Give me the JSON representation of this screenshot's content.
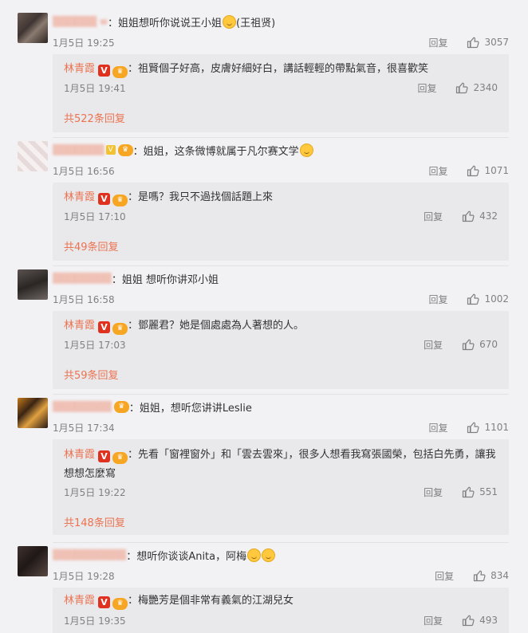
{
  "comments": [
    {
      "user_name": "",
      "text": "姐姐想听你说说王小姐",
      "text_suffix": "(王祖贤)",
      "emoji": [
        "smile-emoji"
      ],
      "time": "1月5日 19:25",
      "reply_label": "回复",
      "likes": "3057",
      "reply": {
        "author": "林青霞",
        "text": "祖賢個子好高，皮膚好細好白，講話輕輕的帶點氣音，很喜歡笑",
        "time": "1月5日 19:41",
        "reply_label": "回复",
        "likes": "2340"
      },
      "more_replies": "共522条回复"
    },
    {
      "user_name": "",
      "text": "姐姐，这条微博就属于凡尔赛文学",
      "text_suffix": "",
      "emoji": [
        "laugh-emoji"
      ],
      "time": "1月5日 16:56",
      "reply_label": "回复",
      "likes": "1071",
      "reply": {
        "author": "林青霞",
        "text": "是嗎？我只不過找個話題上來",
        "time": "1月5日 17:10",
        "reply_label": "回复",
        "likes": "432"
      },
      "more_replies": "共49条回复"
    },
    {
      "user_name": "",
      "text": "姐姐 想听你讲邓小姐",
      "text_suffix": "",
      "emoji": [],
      "time": "1月5日 16:58",
      "reply_label": "回复",
      "likes": "1002",
      "reply": {
        "author": "林青霞",
        "text": "鄧麗君？她是個處處為人著想的人。",
        "time": "1月5日 17:03",
        "reply_label": "回复",
        "likes": "670"
      },
      "more_replies": "共59条回复"
    },
    {
      "user_name": "",
      "text": "姐姐，想听您讲讲Leslie",
      "text_suffix": "",
      "emoji": [],
      "time": "1月5日 17:34",
      "reply_label": "回复",
      "likes": "1101",
      "reply": {
        "author": "林青霞",
        "text": "先看「窗裡窗外」和「雲去雲來」，很多人想看我寫張國榮，包括白先勇，讓我想想怎麼寫",
        "time": "1月5日 19:22",
        "reply_label": "回复",
        "likes": "551"
      },
      "more_replies": "共148条回复"
    },
    {
      "user_name": "",
      "text": "想听你谈谈Anita，阿梅",
      "text_suffix": "",
      "emoji": [
        "grin-emoji",
        "grin-emoji"
      ],
      "time": "1月5日 19:28",
      "reply_label": "回复",
      "likes": "834",
      "reply": {
        "author": "林青霞",
        "text": "梅艷芳是個非常有義氣的江湖兒女",
        "time": "1月5日 19:35",
        "reply_label": "回复",
        "likes": "493"
      },
      "more_replies": ""
    }
  ],
  "icons": {
    "verified": "verified-v-icon",
    "fan": "fan-badge-icon",
    "like": "thumbs-up-icon"
  },
  "colors": {
    "accent": "#eb7350",
    "meta_text": "#808080",
    "reply_bg": "#e9e9ec",
    "page_bg": "#f2f2f5"
  }
}
